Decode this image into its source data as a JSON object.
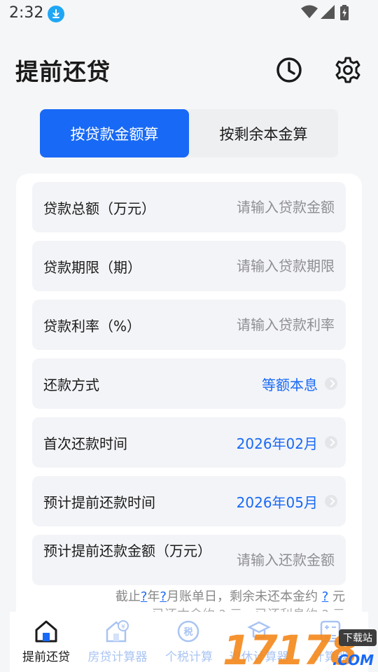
{
  "status_bar": {
    "time": "2:32",
    "icons": [
      "download-icon",
      "wifi-icon",
      "signal-icon",
      "battery-icon"
    ]
  },
  "header": {
    "title": "提前还贷",
    "icons": [
      "history-icon",
      "settings-icon"
    ]
  },
  "tabs": [
    {
      "label": "按贷款金额算",
      "selected": true
    },
    {
      "label": "按剩余本金算",
      "selected": false
    }
  ],
  "form": {
    "rows": [
      {
        "label": "贷款总额（万元）",
        "placeholder": "请输入贷款金额"
      },
      {
        "label": "贷款期限（期）",
        "placeholder": "请输入贷款期限"
      },
      {
        "label": "贷款利率（%）",
        "placeholder": "请输入贷款利率"
      },
      {
        "label": "还款方式",
        "value": "等额本息"
      },
      {
        "label": "首次还款时间",
        "value": "2026年02月"
      },
      {
        "label": "预计提前还款时间",
        "value": "2026年05月"
      },
      {
        "label": "预计提前还款金额（万元）",
        "placeholder": "请输入还款金额"
      }
    ]
  },
  "summary": {
    "p1": "截止",
    "q1": "?",
    "p2": "年",
    "q2": "?",
    "p3": "月账单日，剩余未还本金约",
    "q3": "?",
    "p4": "元",
    "line2": "已还本金约 ? 元，已还利息约 ? 元"
  },
  "bottom_nav": [
    {
      "label": "提前还贷",
      "icon": "home-icon",
      "active": true
    },
    {
      "label": "房贷计算器",
      "icon": "house-yen-icon",
      "active": false
    },
    {
      "label": "个税计算",
      "icon": "tax-icon",
      "active": false
    },
    {
      "label": "退休计算器",
      "icon": "retire-icon",
      "active": false
    },
    {
      "label": "计算器",
      "icon": "calculator-icon",
      "active": false
    }
  ],
  "watermark": {
    "text": "17178",
    "badge": "下载站",
    "suffix": ".COM"
  },
  "colors": {
    "accent": "#1869f5",
    "background": "#f5f6f8",
    "field_bg": "#f3f4f7",
    "placeholder": "#8e8e93",
    "nav_inactive": "#a9c4f3"
  }
}
